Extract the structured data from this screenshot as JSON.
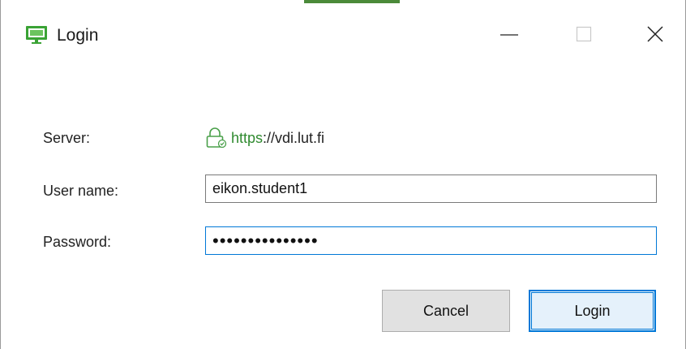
{
  "window": {
    "title": "Login",
    "accent_color": "#4b8a3a"
  },
  "titlebar": {
    "app_icon": "monitor-icon",
    "minimize_icon": "minimize-icon",
    "maximize_icon": "maximize-icon",
    "close_icon": "close-icon"
  },
  "form": {
    "server_label": "Server:",
    "server_scheme": "https",
    "server_rest": "://vdi.lut.fi",
    "server_icon": "lock-icon",
    "username_label": "User name:",
    "username_value": "eikon.student1",
    "password_label": "Password:",
    "password_value": "•••••••••••••••"
  },
  "buttons": {
    "cancel_label": "Cancel",
    "login_label": "Login"
  },
  "colors": {
    "focus_blue": "#0078d7",
    "secure_green": "#2f8a2f"
  }
}
